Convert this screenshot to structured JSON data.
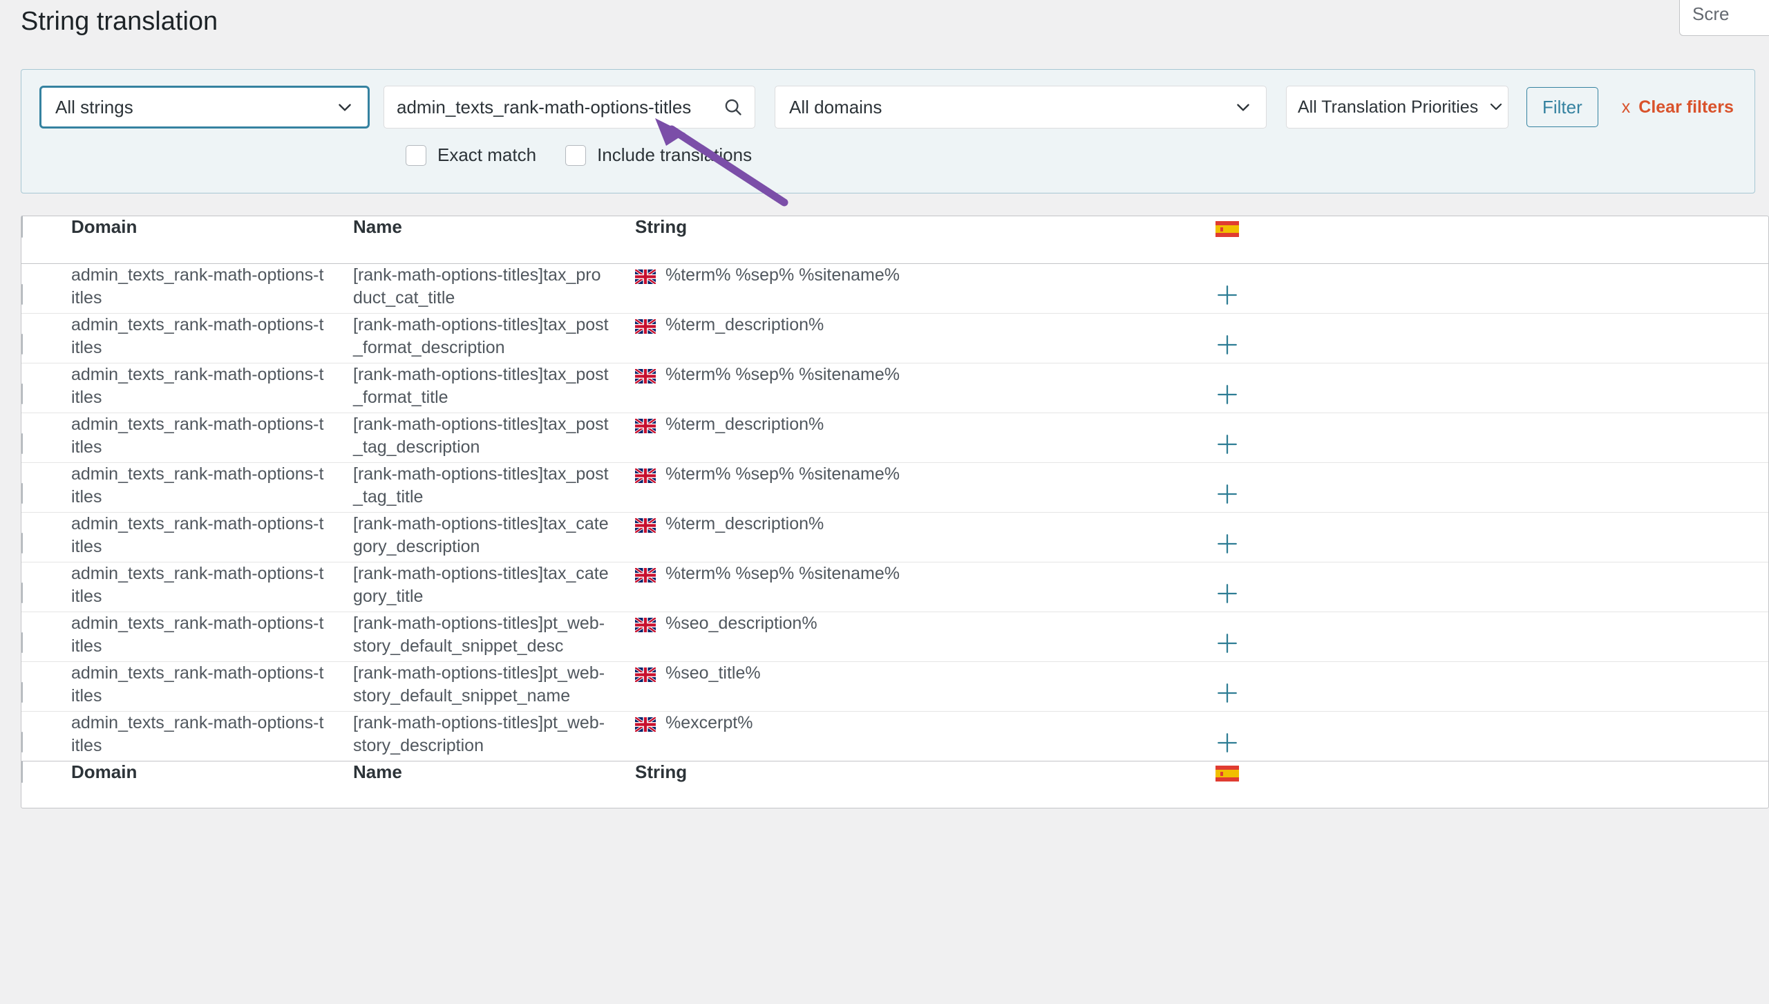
{
  "page": {
    "title": "String translation",
    "screen_options_label": "Scre"
  },
  "filters": {
    "string_scope_select": {
      "value": "All strings",
      "icon": "chevron-down-icon"
    },
    "search": {
      "value": "admin_texts_rank-math-options-titles",
      "placeholder": "Search",
      "icon": "search-icon"
    },
    "domain_select": {
      "value": "All domains",
      "icon": "chevron-down-icon"
    },
    "priority_select": {
      "value": "All Translation Priorities",
      "icon": "chevron-down-icon"
    },
    "filter_button": "Filter",
    "clear_filters": {
      "x": "x",
      "label": "Clear filters"
    },
    "checkboxes": [
      {
        "label": "Exact match",
        "checked": false
      },
      {
        "label": "Include translations",
        "checked": false
      }
    ]
  },
  "table": {
    "headers": {
      "select_all": "",
      "domain": "Domain",
      "name": "Name",
      "string": "String",
      "language_flag": "spain-flag-icon"
    },
    "footers": {
      "domain": "Domain",
      "name": "Name",
      "string": "String",
      "language_flag": "spain-flag-icon"
    },
    "rows": [
      {
        "domain": "admin_texts_rank-math-options-titles",
        "name": "[rank-math-options-titles]tax_product_cat_title",
        "string": "%term% %sep% %sitename%",
        "string_flag": "uk-flag-icon",
        "add_translation": "plus-icon"
      },
      {
        "domain": "admin_texts_rank-math-options-titles",
        "name": "[rank-math-options-titles]tax_post_format_description",
        "string": "%term_description%",
        "string_flag": "uk-flag-icon",
        "add_translation": "plus-icon"
      },
      {
        "domain": "admin_texts_rank-math-options-titles",
        "name": "[rank-math-options-titles]tax_post_format_title",
        "string": "%term% %sep% %sitename%",
        "string_flag": "uk-flag-icon",
        "add_translation": "plus-icon"
      },
      {
        "domain": "admin_texts_rank-math-options-titles",
        "name": "[rank-math-options-titles]tax_post_tag_description",
        "string": "%term_description%",
        "string_flag": "uk-flag-icon",
        "add_translation": "plus-icon"
      },
      {
        "domain": "admin_texts_rank-math-options-titles",
        "name": "[rank-math-options-titles]tax_post_tag_title",
        "string": "%term% %sep% %sitename%",
        "string_flag": "uk-flag-icon",
        "add_translation": "plus-icon"
      },
      {
        "domain": "admin_texts_rank-math-options-titles",
        "name": "[rank-math-options-titles]tax_category_description",
        "string": "%term_description%",
        "string_flag": "uk-flag-icon",
        "add_translation": "plus-icon"
      },
      {
        "domain": "admin_texts_rank-math-options-titles",
        "name": "[rank-math-options-titles]tax_category_title",
        "string": "%term% %sep% %sitename%",
        "string_flag": "uk-flag-icon",
        "add_translation": "plus-icon"
      },
      {
        "domain": "admin_texts_rank-math-options-titles",
        "name": "[rank-math-options-titles]pt_web-story_default_snippet_desc",
        "string": "%seo_description%",
        "string_flag": "uk-flag-icon",
        "add_translation": "plus-icon"
      },
      {
        "domain": "admin_texts_rank-math-options-titles",
        "name": "[rank-math-options-titles]pt_web-story_default_snippet_name",
        "string": "%seo_title%",
        "string_flag": "uk-flag-icon",
        "add_translation": "plus-icon"
      },
      {
        "domain": "admin_texts_rank-math-options-titles",
        "name": "[rank-math-options-titles]pt_web-story_description",
        "string": "%excerpt%",
        "string_flag": "uk-flag-icon",
        "add_translation": "plus-icon"
      }
    ]
  },
  "annotation": {
    "type": "arrow",
    "color": "#7b4ea8",
    "points_to": "search-input"
  },
  "colors": {
    "panel_bg": "#eef4f6",
    "panel_border": "#a7c7d3",
    "accent": "#3582a0",
    "clear_filters": "#d9522b",
    "page_bg": "#f0f0f1",
    "text": "#2c3338",
    "muted_text": "#50575e"
  }
}
